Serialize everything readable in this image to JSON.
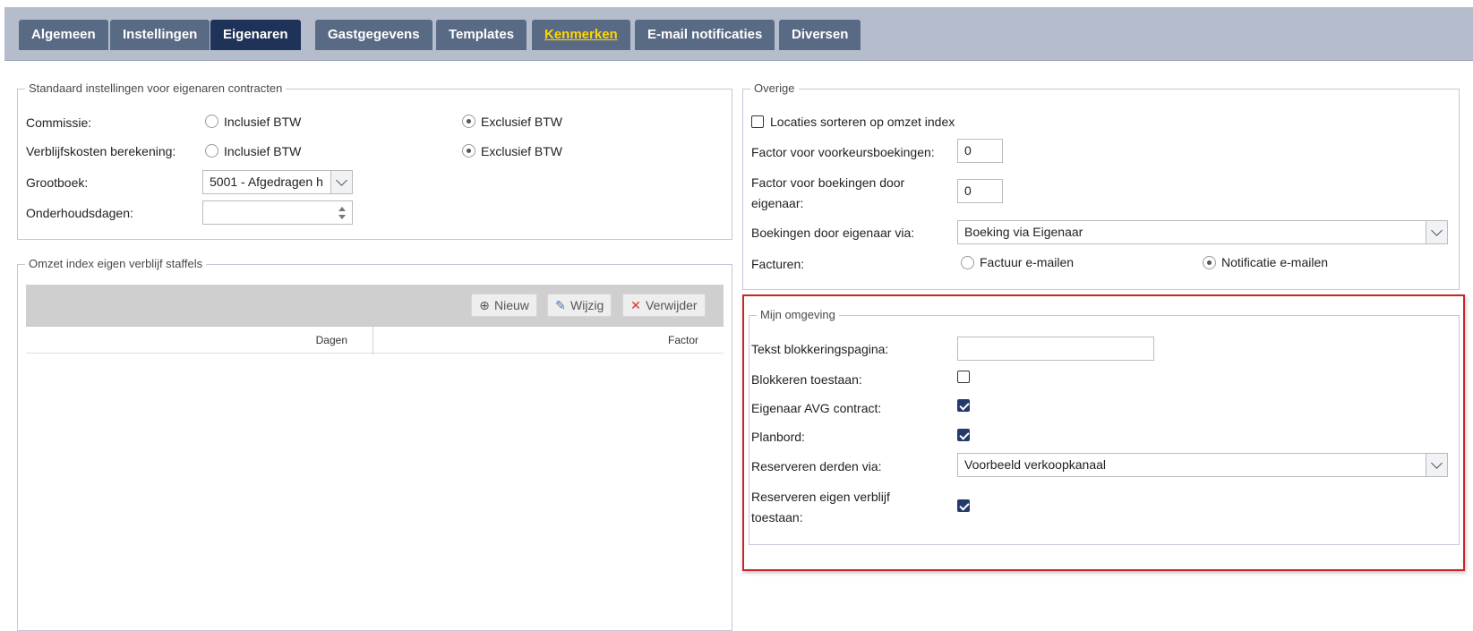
{
  "tabs": [
    {
      "label": "Algemeen",
      "active": false
    },
    {
      "label": "Instellingen",
      "active": false
    },
    {
      "label": "Eigenaren",
      "active": true
    },
    {
      "label": "Gastgegevens",
      "active": false
    },
    {
      "label": "Templates",
      "active": false
    },
    {
      "label": "Kenmerken",
      "active": false,
      "highlight": true
    },
    {
      "label": "E-mail notificaties",
      "active": false
    },
    {
      "label": "Diversen",
      "active": false
    }
  ],
  "standaard": {
    "legend": "Standaard instellingen voor eigenaren contracten",
    "commissie_label": "Commissie:",
    "verblijf_label": "Verblijfskosten berekening:",
    "opt_incl": "Inclusief BTW",
    "opt_excl": "Exclusief BTW",
    "commissie_value": "Exclusief BTW",
    "verblijf_value": "Exclusief BTW",
    "grootboek_label": "Grootboek:",
    "grootboek_value": "5001 - Afgedragen h",
    "onderhoud_label": "Onderhoudsdagen:",
    "onderhoud_value": ""
  },
  "omzet": {
    "legend": "Omzet index eigen verblijf staffels",
    "btn_new": "Nieuw",
    "btn_edit": "Wijzig",
    "btn_delete": "Verwijder",
    "columns": [
      "Dagen",
      "Factor"
    ]
  },
  "overige": {
    "legend": "Overige",
    "sort_label": "Locaties sorteren op omzet index",
    "sort_checked": false,
    "voorkeur_label": "Factor voor voorkeursboekingen:",
    "voorkeur_value": "0",
    "eigenaar_factor_label_1": "Factor voor boekingen door",
    "eigenaar_factor_label_2": "eigenaar:",
    "eigenaar_factor_value": "0",
    "boekingen_label": "Boekingen door eigenaar via:",
    "boekingen_value": "Boeking via Eigenaar",
    "facturen_label": "Facturen:",
    "opt_factuur": "Factuur e-mailen",
    "opt_notificatie": "Notificatie e-mailen",
    "facturen_value": "Notificatie e-mailen"
  },
  "mijn": {
    "legend": "Mijn omgeving",
    "tekst_label": "Tekst blokkeringspagina:",
    "tekst_value": "",
    "blokkeren_label": "Blokkeren toestaan:",
    "blokkeren_checked": false,
    "avg_label": "Eigenaar AVG contract:",
    "avg_checked": true,
    "planbord_label": "Planbord:",
    "planbord_checked": true,
    "derden_label": "Reserveren derden via:",
    "derden_value": "Voorbeeld verkoopkanaal",
    "eigen_label_1": "Reserveren eigen verblijf",
    "eigen_label_2": "toestaan:",
    "eigen_checked": true
  },
  "colors": {
    "tab": "#596a85",
    "tab_active": "#1f3358",
    "tabbar": "#b5bdcd",
    "highlight": "#c8262b",
    "check": "#243a6b"
  }
}
